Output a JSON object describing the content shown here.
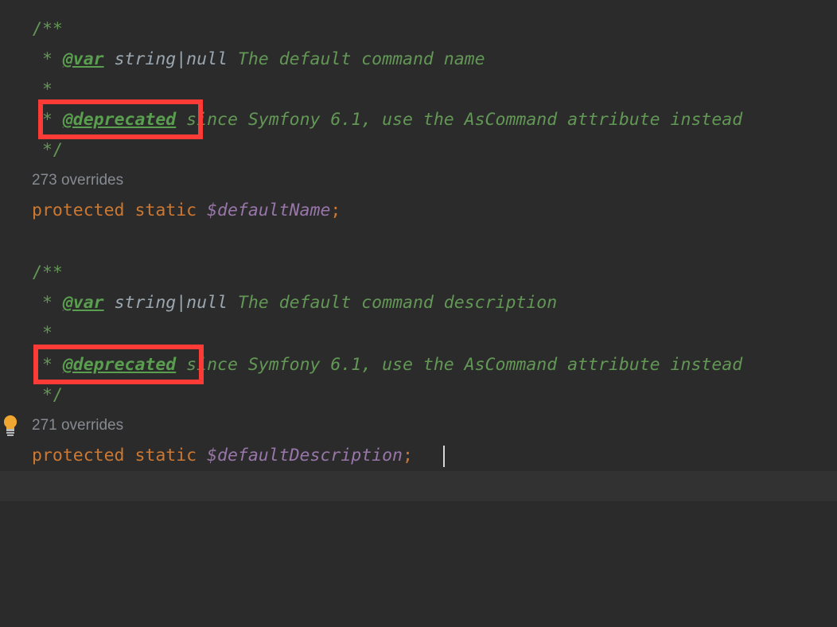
{
  "editor": {
    "background_color": "#2b2b2b",
    "current_line_color": "#323232",
    "language": "PHP",
    "colors": {
      "comment": "#629755",
      "doc_tag": "#5a9e4f",
      "type": "#9aa7b0",
      "keyword": "#cc7832",
      "field": "#9876aa",
      "hint": "#868a91",
      "annotation": "#fc3a36",
      "bulb": "#f0a732"
    }
  },
  "blocks": [
    {
      "id": "default-name",
      "doc_open": "/**",
      "var_line": {
        "star": " * ",
        "tag": "@var",
        "type": " string|null",
        "text": " The default command name"
      },
      "blank_star": " *",
      "deprecated_line": {
        "star": " * ",
        "tag": "@deprecated",
        "text": " since Symfony 6.1, use the AsCommand attribute instead"
      },
      "doc_close": " */",
      "overrides_hint": "273 overrides",
      "declaration": {
        "keywords": "protected static ",
        "field": "$defaultName",
        "semicolon": ";"
      }
    },
    {
      "id": "default-description",
      "doc_open": "/**",
      "var_line": {
        "star": " * ",
        "tag": "@var",
        "type": " string|null",
        "text": " The default command description"
      },
      "blank_star": " *",
      "deprecated_line": {
        "star": " * ",
        "tag": "@deprecated",
        "text": " since Symfony 6.1, use the AsCommand attribute instead"
      },
      "doc_close": " */",
      "overrides_hint": "271 overrides",
      "declaration": {
        "keywords": "protected static ",
        "field": "$defaultDescription",
        "semicolon": ";"
      }
    }
  ],
  "gutter": {
    "intention_bulb_label": "Show Context Actions"
  },
  "annotations": [
    {
      "label": "deprecated-tag-highlight-1"
    },
    {
      "label": "deprecated-tag-highlight-2"
    }
  ]
}
